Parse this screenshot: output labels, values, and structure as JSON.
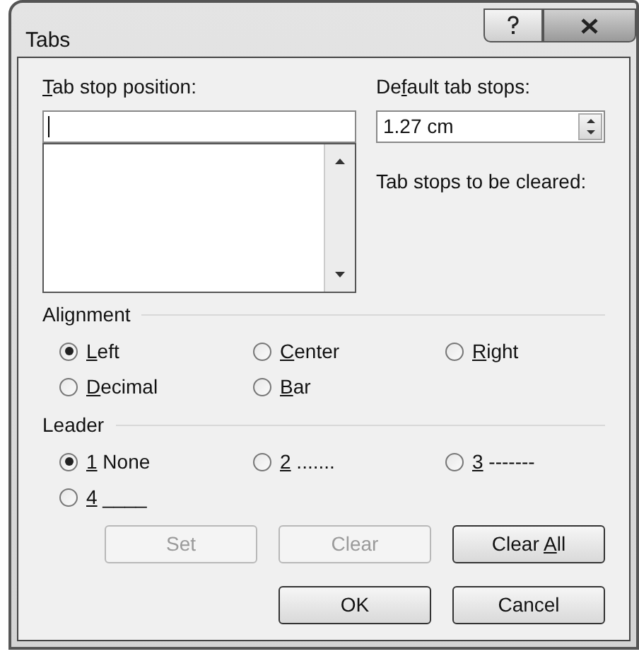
{
  "window": {
    "title": "Tabs"
  },
  "tab_stop_position": {
    "label": [
      {
        "text": "T",
        "underlined": true
      },
      {
        "text": "ab stop position:",
        "underlined": false
      }
    ]
  },
  "default_tab_stops": {
    "label": [
      {
        "text": "De",
        "underlined": false
      },
      {
        "text": "f",
        "underlined": true
      },
      {
        "text": "ault tab stops:",
        "underlined": false
      }
    ],
    "value": "1.27 cm"
  },
  "tab_stops_to_be_cleared": {
    "label": [
      {
        "text": "Tab stops to be cleared:",
        "underlined": false
      }
    ]
  },
  "alignment": {
    "title": "Alignment",
    "options": [
      {
        "label": [
          {
            "text": "L",
            "underlined": true
          },
          {
            "text": "eft",
            "underlined": false
          }
        ],
        "selected": true
      },
      {
        "label": [
          {
            "text": "C",
            "underlined": true
          },
          {
            "text": "enter",
            "underlined": false
          }
        ],
        "selected": false
      },
      {
        "label": [
          {
            "text": "R",
            "underlined": true
          },
          {
            "text": "ight",
            "underlined": false
          }
        ],
        "selected": false
      },
      {
        "label": [
          {
            "text": "D",
            "underlined": true
          },
          {
            "text": "ecimal",
            "underlined": false
          }
        ],
        "selected": false
      },
      {
        "label": [
          {
            "text": "B",
            "underlined": true
          },
          {
            "text": "ar",
            "underlined": false
          }
        ],
        "selected": false
      }
    ]
  },
  "leader": {
    "title": "Leader",
    "options": [
      {
        "label": [
          {
            "text": "1",
            "underlined": true
          },
          {
            "text": " None",
            "underlined": false
          }
        ],
        "selected": true
      },
      {
        "label": [
          {
            "text": "2",
            "underlined": true
          },
          {
            "text": " .......",
            "underlined": false
          }
        ],
        "selected": false
      },
      {
        "label": [
          {
            "text": "3",
            "underlined": true
          },
          {
            "text": " -------",
            "underlined": false
          }
        ],
        "selected": false
      },
      {
        "label": [
          {
            "text": "4",
            "underlined": true
          },
          {
            "text": " ____",
            "underlined": false
          }
        ],
        "selected": false
      }
    ]
  },
  "buttons": [
    {
      "label": [
        {
          "text": "Set",
          "underlined": false
        }
      ],
      "disabled": true
    },
    {
      "label": [
        {
          "text": "Clear",
          "underlined": false
        }
      ],
      "disabled": true
    },
    {
      "label": [
        {
          "text": "Clear ",
          "underlined": false
        },
        {
          "text": "A",
          "underlined": true
        },
        {
          "text": "ll",
          "underlined": false
        }
      ],
      "disabled": false
    }
  ],
  "dialog_buttons": [
    {
      "label": [
        {
          "text": "OK",
          "underlined": false
        }
      ]
    },
    {
      "label": [
        {
          "text": "Cancel",
          "underlined": false
        }
      ]
    }
  ]
}
